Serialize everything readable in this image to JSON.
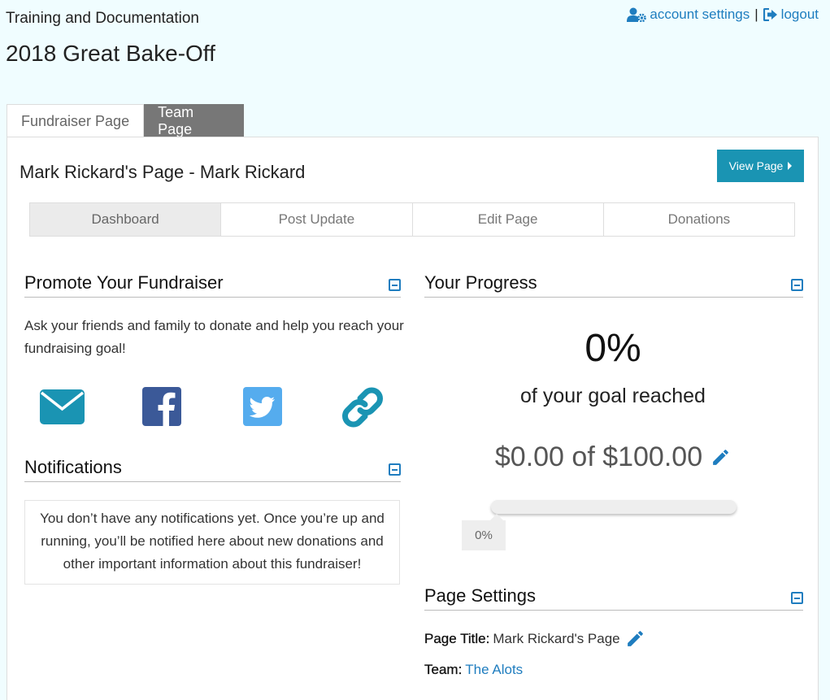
{
  "header": {
    "org_name": "Training and Documentation",
    "event_title": "2018 Great Bake-Off",
    "account_settings": "account settings",
    "separator": "|",
    "logout": "logout"
  },
  "tabs": [
    {
      "label": "Fundraiser Page",
      "active": true
    },
    {
      "label": "Team Page",
      "active": false
    }
  ],
  "panel": {
    "page_heading": "Mark Rickard's Page - Mark Rickard",
    "view_page_label": "View Page"
  },
  "subnav": [
    {
      "label": "Dashboard",
      "active": true
    },
    {
      "label": "Post Update",
      "active": false
    },
    {
      "label": "Edit Page",
      "active": false
    },
    {
      "label": "Donations",
      "active": false
    }
  ],
  "promote": {
    "title": "Promote Your Fundraiser",
    "text": "Ask your friends and family to donate and help you reach your fundraising goal!",
    "icons": [
      "email-icon",
      "facebook-icon",
      "twitter-icon",
      "link-icon"
    ]
  },
  "notifications": {
    "title": "Notifications",
    "text": "You don’t have any notifications yet. Once you’re up and running, you’ll be notified here about new donations and other important information about this fundraiser!"
  },
  "progress": {
    "title": "Your Progress",
    "percent_text": "0%",
    "goal_text": "of your goal reached",
    "amount_text": "$0.00 of $100.00",
    "fraction": 0,
    "bar_label": "0%"
  },
  "settings": {
    "title": "Page Settings",
    "page_title_label": "Page Title:",
    "page_title_value": "Mark Rickard's Page",
    "team_label": "Team:",
    "team_value": "The Alots"
  },
  "colors": {
    "background": "#f0fdff",
    "link": "#1f7dbf",
    "button": "#1a94b3",
    "facebook": "#3b5998",
    "twitter": "#55acee",
    "email": "#1a94b3"
  }
}
